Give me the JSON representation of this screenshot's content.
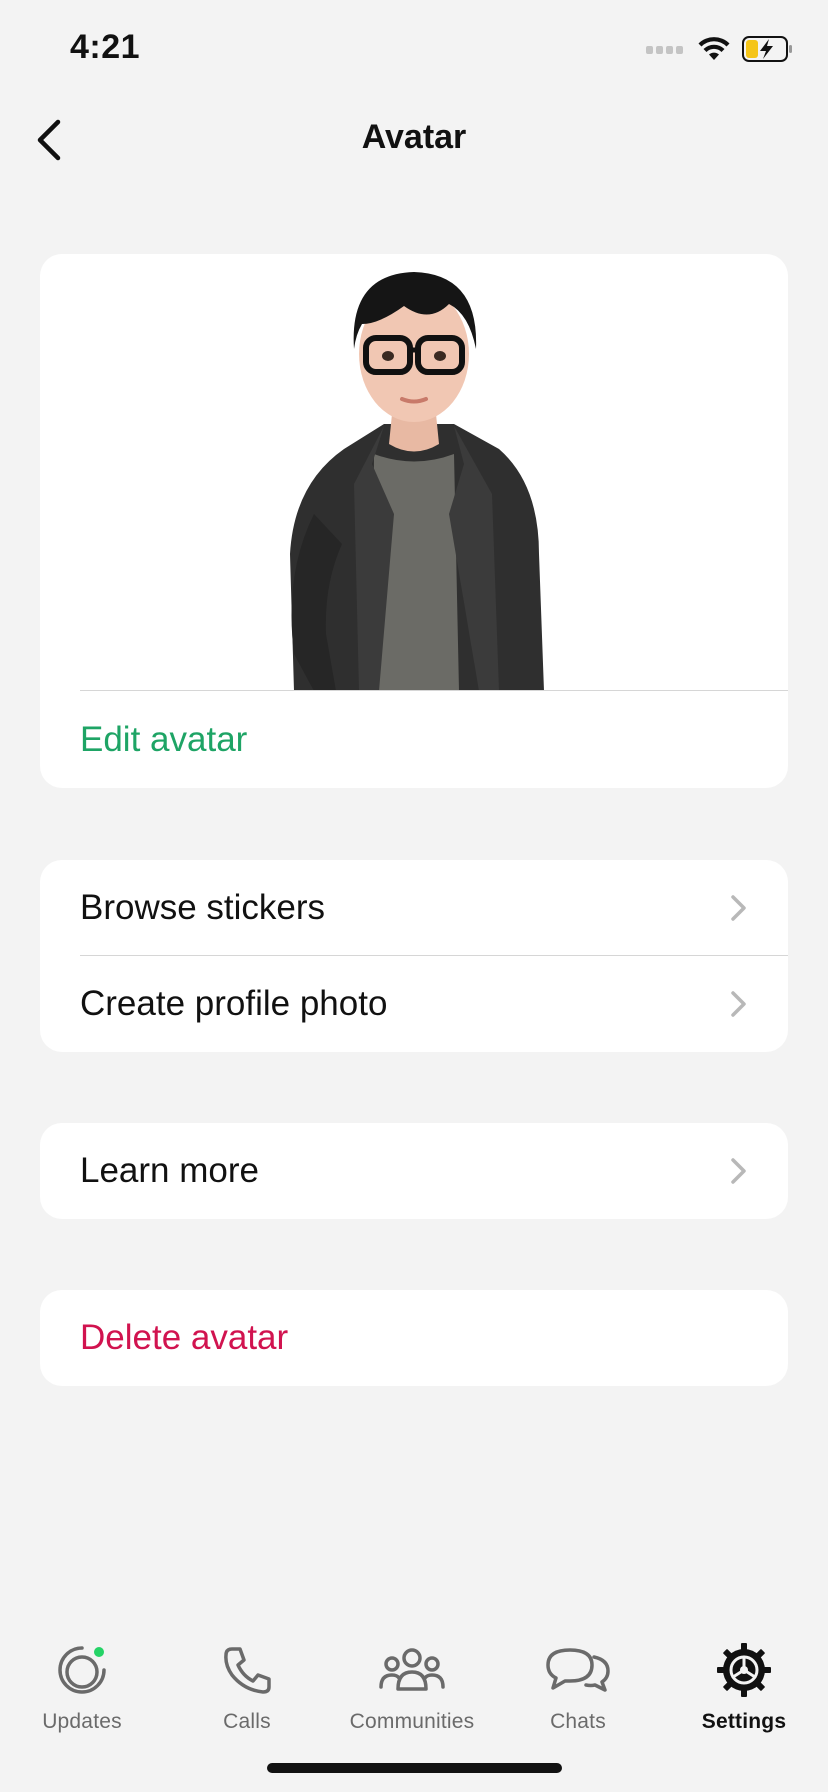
{
  "status_bar": {
    "time": "4:21",
    "icons": [
      "cellular-signal-icon",
      "wifi-icon",
      "battery-charging-icon"
    ]
  },
  "header": {
    "title": "Avatar",
    "back_icon": "chevron-left-icon"
  },
  "avatar_card": {
    "edit_label": "Edit avatar"
  },
  "options": {
    "items": [
      {
        "label": "Browse stickers",
        "icon": "chevron-right-icon"
      },
      {
        "label": "Create profile photo",
        "icon": "chevron-right-icon"
      }
    ]
  },
  "learn_more": {
    "label": "Learn more",
    "icon": "chevron-right-icon"
  },
  "delete": {
    "label": "Delete avatar"
  },
  "tab_bar": {
    "tabs": [
      {
        "label": "Updates",
        "icon": "updates-icon",
        "active": false,
        "badge": true
      },
      {
        "label": "Calls",
        "icon": "phone-icon",
        "active": false
      },
      {
        "label": "Communities",
        "icon": "communities-icon",
        "active": false
      },
      {
        "label": "Chats",
        "icon": "chats-icon",
        "active": false
      },
      {
        "label": "Settings",
        "icon": "settings-gear-icon",
        "active": true
      }
    ]
  },
  "colors": {
    "accent_green": "#1ea465",
    "destructive_red": "#d1134f",
    "background": "#f3f3f3",
    "card": "#ffffff"
  }
}
